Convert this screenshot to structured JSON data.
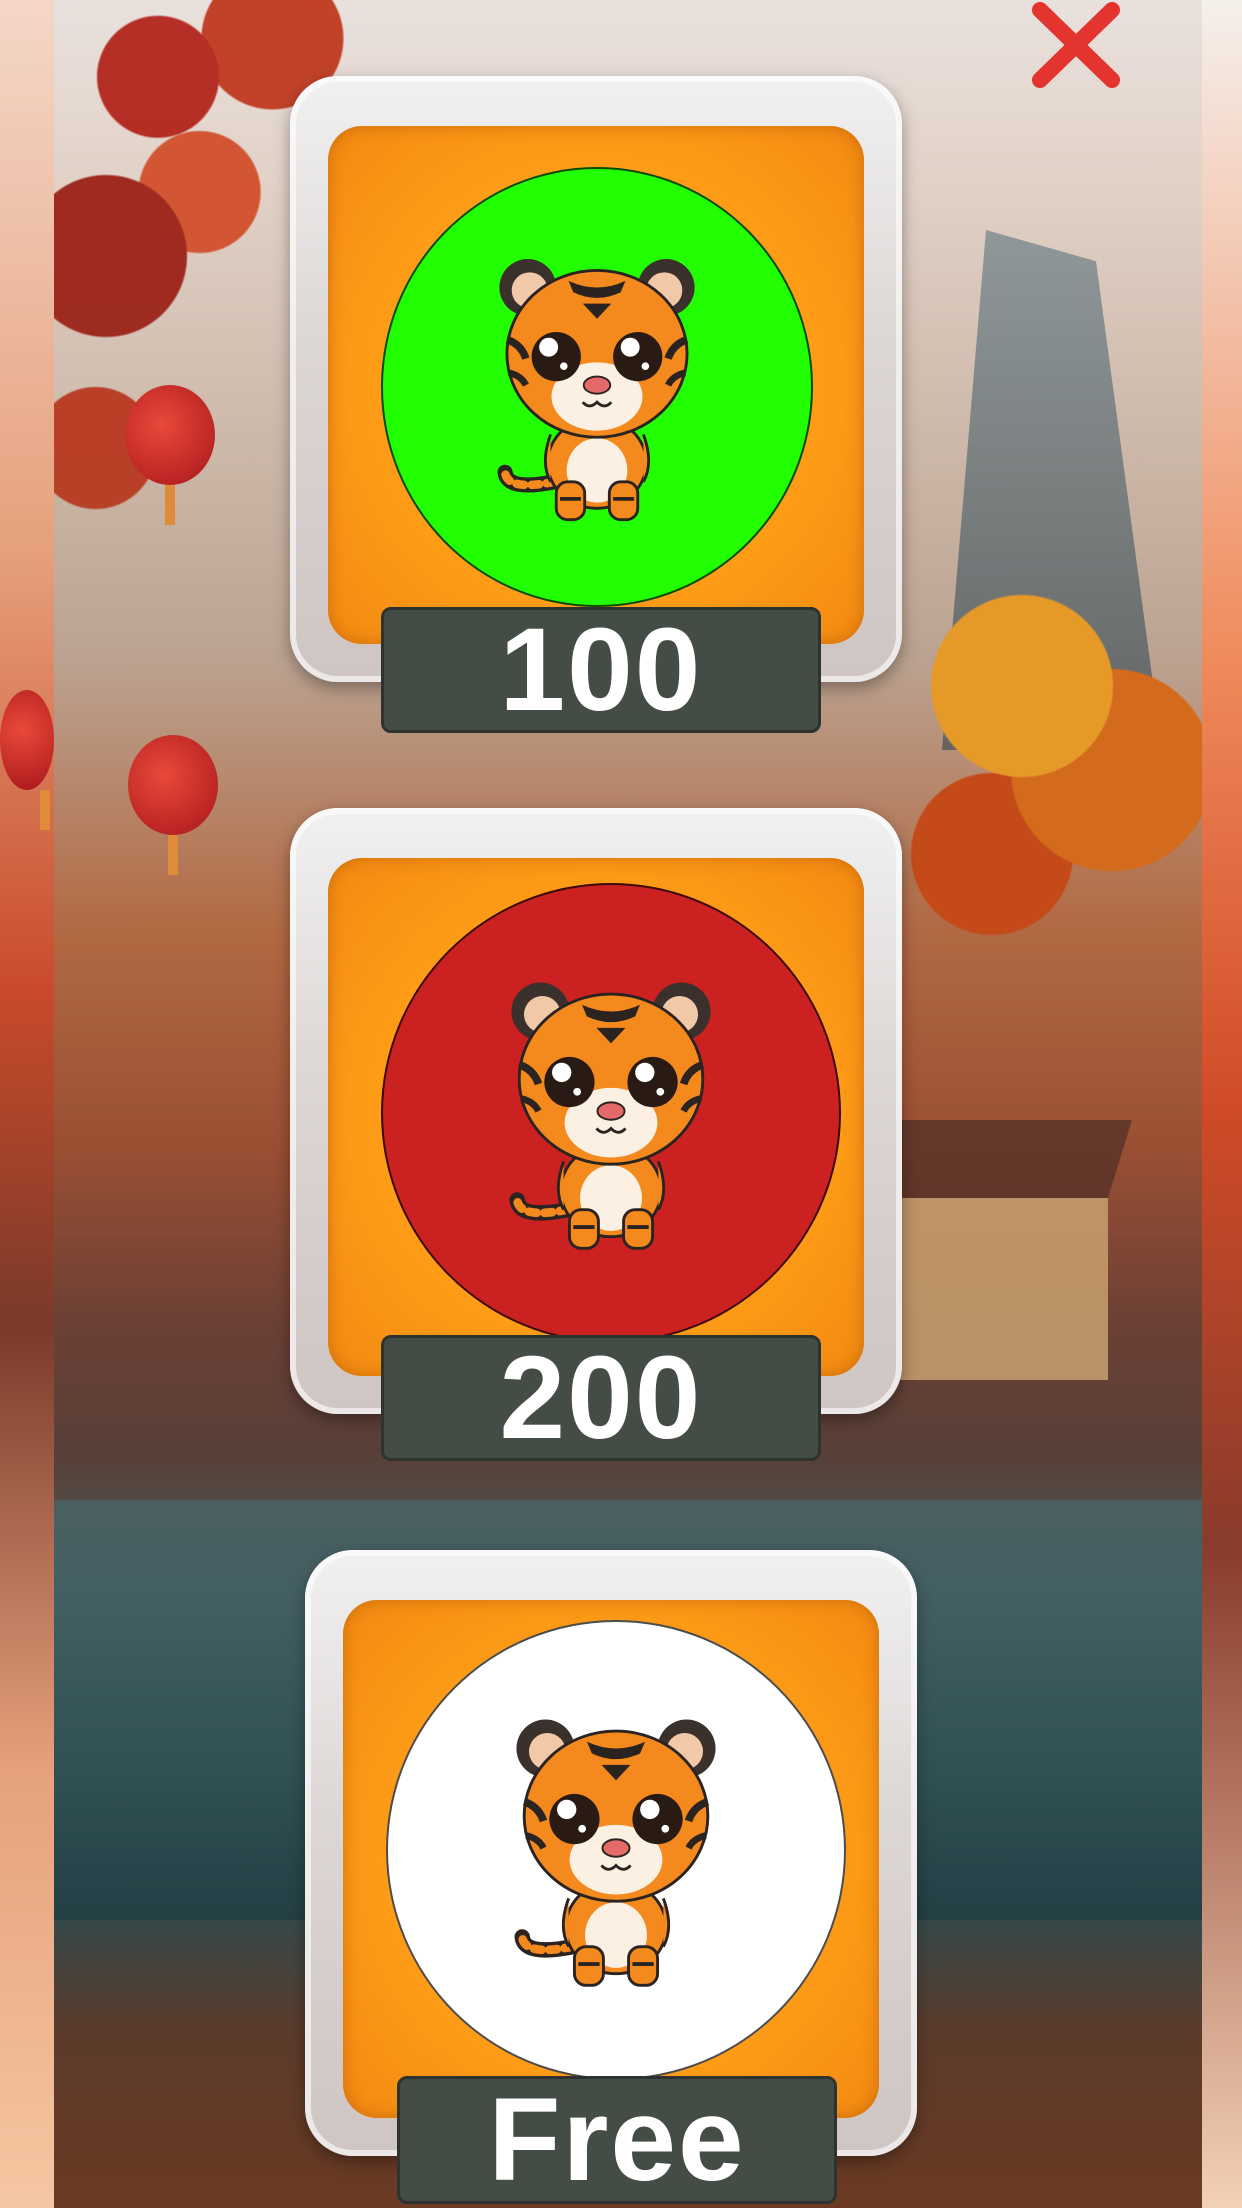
{
  "screen": {
    "close_icon": "close-x-icon",
    "close_color": "#e4342f"
  },
  "skins": [
    {
      "price": "100",
      "circle_color": "#22ff00",
      "icon": "tiger-cub-icon"
    },
    {
      "price": "200",
      "circle_color": "#cc2121",
      "icon": "tiger-cub-icon"
    },
    {
      "price": "Free",
      "circle_color": "#ffffff",
      "icon": "tiger-cub-icon"
    }
  ]
}
